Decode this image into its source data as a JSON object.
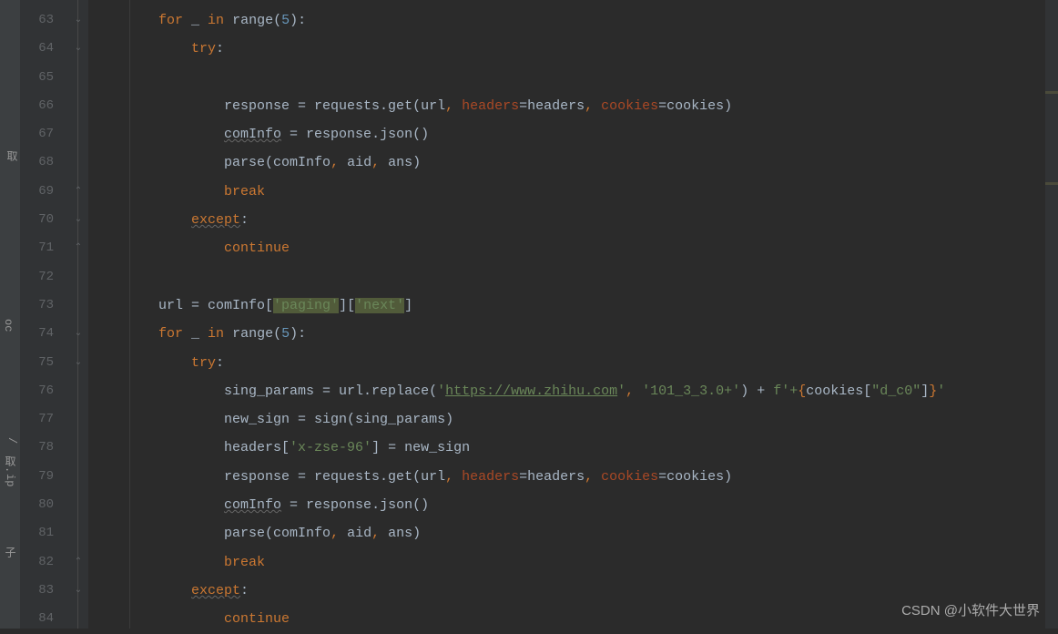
{
  "watermark": "CSDN @小软件大世界",
  "sidebar": {
    "label1": "取",
    "label2": "oc",
    "label3": "/",
    "label4": "取.",
    "label5": "ip",
    "label6": "子"
  },
  "gutter": {
    "start": 63,
    "end": 84
  },
  "code": {
    "lines": [
      {
        "indent": 2,
        "tokens": [
          {
            "t": "for ",
            "c": "k"
          },
          {
            "t": "_ ",
            "c": "c"
          },
          {
            "t": "in ",
            "c": "k"
          },
          {
            "t": "range(",
            "c": "c"
          },
          {
            "t": "5",
            "c": "n"
          },
          {
            "t": "):",
            "c": "c"
          }
        ]
      },
      {
        "indent": 3,
        "tokens": [
          {
            "t": "try",
            "c": "k"
          },
          {
            "t": ":",
            "c": "c"
          }
        ]
      },
      {
        "indent": 0,
        "tokens": []
      },
      {
        "indent": 4,
        "tokens": [
          {
            "t": "response = requests.get(url",
            "c": "c"
          },
          {
            "t": ", ",
            "c": "k"
          },
          {
            "t": "headers",
            "c": "param"
          },
          {
            "t": "=headers",
            "c": "c"
          },
          {
            "t": ", ",
            "c": "k"
          },
          {
            "t": "cookies",
            "c": "param"
          },
          {
            "t": "=cookies)",
            "c": "c"
          }
        ]
      },
      {
        "indent": 4,
        "tokens": [
          {
            "t": "comInfo",
            "c": "c underwave"
          },
          {
            "t": " = response.json()",
            "c": "c"
          }
        ]
      },
      {
        "indent": 4,
        "tokens": [
          {
            "t": "parse(comInfo",
            "c": "c"
          },
          {
            "t": ", ",
            "c": "k"
          },
          {
            "t": "aid",
            "c": "c"
          },
          {
            "t": ", ",
            "c": "k"
          },
          {
            "t": "ans)",
            "c": "c"
          }
        ]
      },
      {
        "indent": 4,
        "tokens": [
          {
            "t": "break",
            "c": "k"
          }
        ]
      },
      {
        "indent": 3,
        "tokens": [
          {
            "t": "except",
            "c": "k underwave"
          },
          {
            "t": ":",
            "c": "c"
          }
        ]
      },
      {
        "indent": 4,
        "tokens": [
          {
            "t": "continue",
            "c": "k"
          }
        ]
      },
      {
        "indent": 0,
        "tokens": []
      },
      {
        "indent": 2,
        "tokens": [
          {
            "t": "url = comInfo[",
            "c": "c"
          },
          {
            "t": "'paging'",
            "c": "s hl"
          },
          {
            "t": "][",
            "c": "c"
          },
          {
            "t": "'next'",
            "c": "s hl"
          },
          {
            "t": "]",
            "c": "c"
          }
        ]
      },
      {
        "indent": 2,
        "tokens": [
          {
            "t": "for ",
            "c": "k"
          },
          {
            "t": "_ ",
            "c": "c"
          },
          {
            "t": "in ",
            "c": "k"
          },
          {
            "t": "range(",
            "c": "c"
          },
          {
            "t": "5",
            "c": "n"
          },
          {
            "t": "):",
            "c": "c"
          }
        ]
      },
      {
        "indent": 3,
        "tokens": [
          {
            "t": "try",
            "c": "k"
          },
          {
            "t": ":",
            "c": "c"
          }
        ]
      },
      {
        "indent": 4,
        "tokens": [
          {
            "t": "sing_params = url.replace(",
            "c": "c"
          },
          {
            "t": "'",
            "c": "s"
          },
          {
            "t": "https://www.zhihu.com",
            "c": "link"
          },
          {
            "t": "'",
            "c": "s"
          },
          {
            "t": ", ",
            "c": "k"
          },
          {
            "t": "'101_3_3.0+'",
            "c": "s"
          },
          {
            "t": ") + ",
            "c": "c"
          },
          {
            "t": "f'+",
            "c": "s"
          },
          {
            "t": "{",
            "c": "k"
          },
          {
            "t": "cookies[",
            "c": "c"
          },
          {
            "t": "\"d_c0\"",
            "c": "s"
          },
          {
            "t": "]",
            "c": "c"
          },
          {
            "t": "}",
            "c": "k"
          },
          {
            "t": "'",
            "c": "s"
          }
        ]
      },
      {
        "indent": 4,
        "tokens": [
          {
            "t": "new_sign = sign(sing_params)",
            "c": "c"
          }
        ]
      },
      {
        "indent": 4,
        "tokens": [
          {
            "t": "headers[",
            "c": "c"
          },
          {
            "t": "'x-zse-96'",
            "c": "s"
          },
          {
            "t": "] = new_sign",
            "c": "c"
          }
        ]
      },
      {
        "indent": 4,
        "tokens": [
          {
            "t": "response = requests.get(url",
            "c": "c"
          },
          {
            "t": ", ",
            "c": "k"
          },
          {
            "t": "headers",
            "c": "param"
          },
          {
            "t": "=headers",
            "c": "c"
          },
          {
            "t": ", ",
            "c": "k"
          },
          {
            "t": "cookies",
            "c": "param"
          },
          {
            "t": "=cookies)",
            "c": "c"
          }
        ]
      },
      {
        "indent": 4,
        "tokens": [
          {
            "t": "comInfo",
            "c": "c underwave"
          },
          {
            "t": " = response.json()",
            "c": "c"
          }
        ]
      },
      {
        "indent": 4,
        "tokens": [
          {
            "t": "parse(comInfo",
            "c": "c"
          },
          {
            "t": ", ",
            "c": "k"
          },
          {
            "t": "aid",
            "c": "c"
          },
          {
            "t": ", ",
            "c": "k"
          },
          {
            "t": "ans)",
            "c": "c"
          }
        ]
      },
      {
        "indent": 4,
        "tokens": [
          {
            "t": "break",
            "c": "k"
          }
        ]
      },
      {
        "indent": 3,
        "tokens": [
          {
            "t": "except",
            "c": "k underwave"
          },
          {
            "t": ":",
            "c": "c"
          }
        ]
      },
      {
        "indent": 4,
        "tokens": [
          {
            "t": "continue",
            "c": "k"
          }
        ]
      }
    ]
  },
  "fold_markers": [
    {
      "line": 0,
      "type": "chevron"
    },
    {
      "line": 1,
      "type": "chevron"
    },
    {
      "line": 6,
      "type": "end"
    },
    {
      "line": 7,
      "type": "chevron"
    },
    {
      "line": 8,
      "type": "end"
    },
    {
      "line": 11,
      "type": "chevron"
    },
    {
      "line": 12,
      "type": "chevron"
    },
    {
      "line": 19,
      "type": "end"
    },
    {
      "line": 20,
      "type": "chevron"
    }
  ]
}
